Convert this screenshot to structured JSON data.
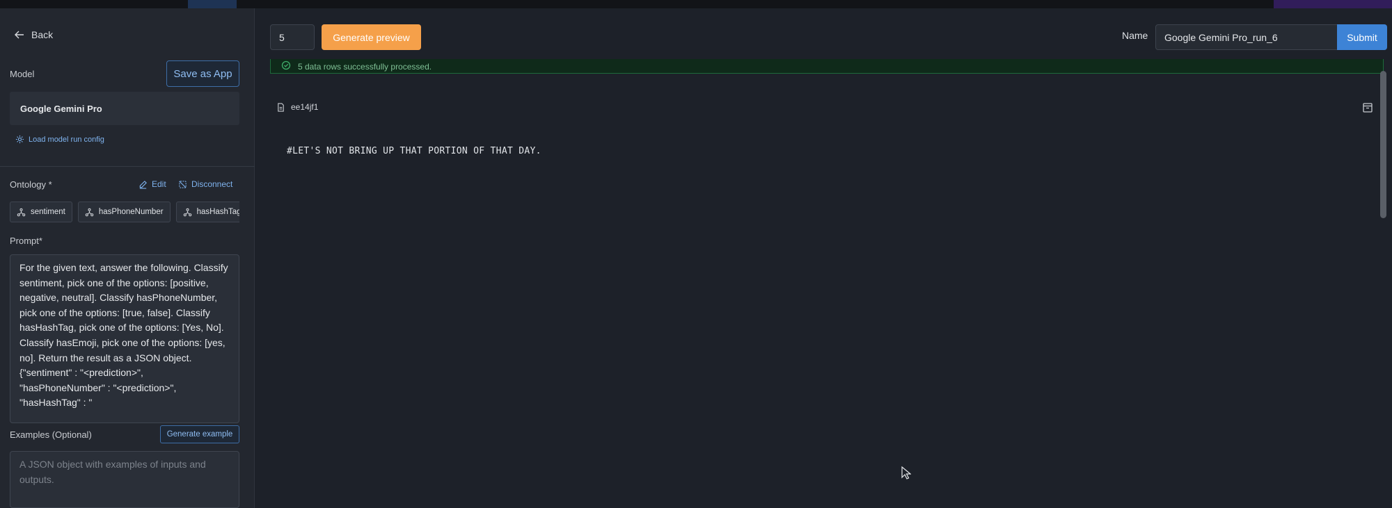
{
  "sidebar": {
    "back_label": "Back",
    "model_label": "Model",
    "save_as_app_label": "Save as App",
    "model_name": "Google Gemini Pro",
    "load_config_label": "Load model run config",
    "ontology_label": "Ontology *",
    "edit_label": "Edit",
    "disconnect_label": "Disconnect",
    "ontology_chips": [
      {
        "label": "sentiment",
        "icon": "classification-icon"
      },
      {
        "label": "hasPhoneNumber",
        "icon": "classification-icon"
      },
      {
        "label": "hasHashTag",
        "icon": "classification-icon"
      }
    ],
    "prompt_label": "Prompt*",
    "prompt_text": "For the given text, answer the following. Classify sentiment, pick one of the options: [positive, negative, neutral]. Classify hasPhoneNumber, pick one of the options: [true, false]. Classify hasHashTag, pick one of the options: [Yes, No]. Classify hasEmoji, pick one of the options: [yes, no]. Return the result as a JSON object. {\"sentiment\" : \"<prediction>\", \"hasPhoneNumber\" : \"<prediction>\", \"hasHashTag\" : \"",
    "examples_label": "Examples (Optional)",
    "generate_example_label": "Generate example",
    "examples_placeholder": "A JSON object with examples of inputs and outputs."
  },
  "toolbar": {
    "row_count": "5",
    "generate_preview_label": "Generate preview",
    "name_label": "Name",
    "name_value": "Google Gemini Pro_run_6",
    "submit_label": "Submit"
  },
  "main": {
    "success_message": "5 data rows successfully processed.",
    "file_id": "ee14jf1",
    "content_text": "#LET'S NOT BRING UP THAT PORTION OF THAT DAY."
  },
  "colors": {
    "accent_orange": "#f5a04a",
    "accent_blue": "#3d83d6",
    "link_blue": "#7fb3ee",
    "success_green": "#1d6a3b"
  }
}
